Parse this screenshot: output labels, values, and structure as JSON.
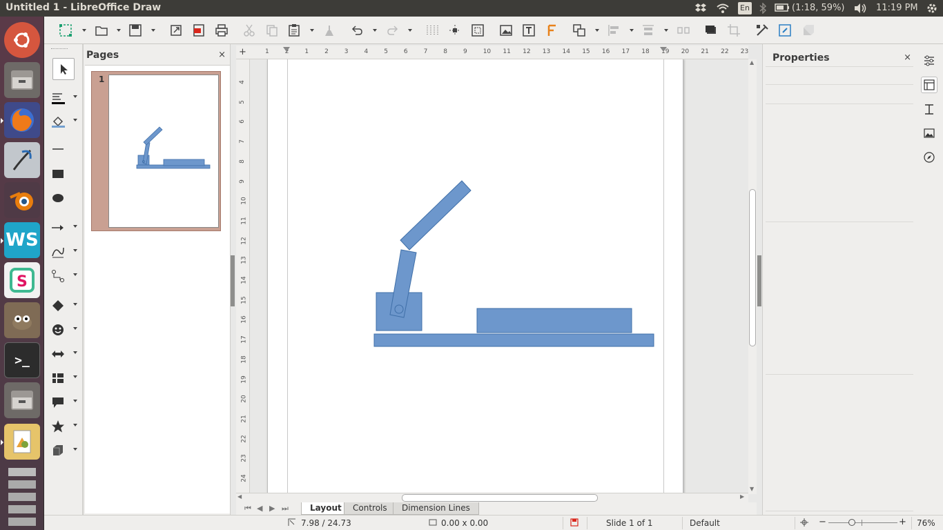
{
  "window": {
    "title": "Untitled 1 - LibreOffice Draw"
  },
  "panel": {
    "battery": "(1:18, 59%)",
    "clock": "11:19 PM",
    "keyboard": "En"
  },
  "launcher": [
    {
      "name": "ubuntu-dash-icon",
      "color": "#d5563e"
    },
    {
      "name": "files-icon",
      "color": "#8a8a8a"
    },
    {
      "name": "firefox-icon",
      "color": "#e66000"
    },
    {
      "name": "quill-icon",
      "color": "#c2c7cc"
    },
    {
      "name": "blender-icon",
      "color": "#e87d0d"
    },
    {
      "name": "webstorm-icon",
      "color": "#23b7a6"
    },
    {
      "name": "slack-icon",
      "color": "#eeeeee"
    },
    {
      "name": "gimp-icon",
      "color": "#7f6b55"
    },
    {
      "name": "terminal-icon",
      "color": "#333333"
    },
    {
      "name": "files-icon",
      "color": "#8a8a8a"
    },
    {
      "name": "libreoffice-draw-icon",
      "color": "#e6c46a"
    }
  ],
  "pages_pane": {
    "title": "Pages",
    "page_number": "1"
  },
  "properties_pane": {
    "title": "Properties"
  },
  "ruler": {
    "h": [
      "1",
      "2",
      "1",
      "2",
      "3",
      "4",
      "5",
      "6",
      "7",
      "8",
      "9",
      "10",
      "11",
      "12",
      "13",
      "14",
      "15",
      "16",
      "17",
      "18",
      "19",
      "20",
      "21",
      "22",
      "23"
    ],
    "v": [
      "4",
      "5",
      "6",
      "7",
      "8",
      "9",
      "10",
      "11",
      "12",
      "13",
      "14",
      "15",
      "16",
      "17",
      "18",
      "19",
      "20",
      "21",
      "22",
      "23",
      "24"
    ]
  },
  "tabs": [
    {
      "label": "Layout",
      "active": true
    },
    {
      "label": "Controls",
      "active": false
    },
    {
      "label": "Dimension Lines",
      "active": false
    }
  ],
  "status": {
    "position": "7.98 / 24.73",
    "size": "0.00 x 0.00",
    "slide": "Slide 1 of 1",
    "master": "Default",
    "zoom": "76%"
  },
  "colors": {
    "shape_fill": "#6d97cc",
    "shape_stroke": "#3f6fa8",
    "accent": "#dd4814"
  }
}
